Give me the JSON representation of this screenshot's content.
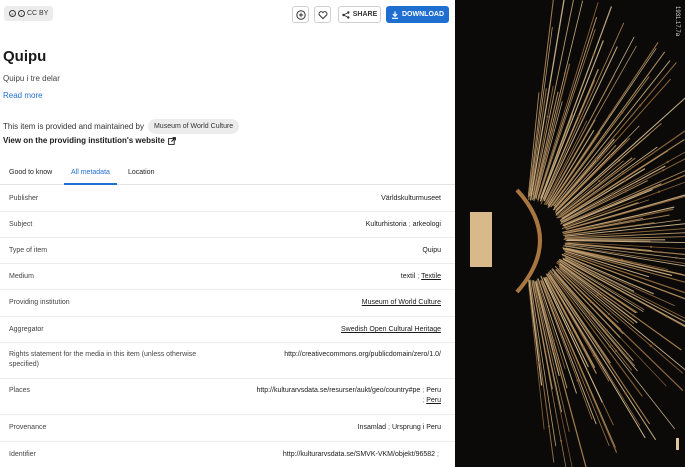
{
  "license": {
    "label": "CC BY"
  },
  "toolbar": {
    "add_icon": "plus-circle-icon",
    "favorite_icon": "heart-icon",
    "share_label": "SHARE",
    "download_label": "DOWNLOAD"
  },
  "item": {
    "title": "Quipu",
    "subtitle": "Quipu i tre delar",
    "read_more": "Read more",
    "provided_text": "This item is provided and maintained by",
    "provider_chip": "Museum of World Culture",
    "view_site": "View on the providing institution's website"
  },
  "tabs": [
    {
      "label": "Good to know"
    },
    {
      "label": "All metadata"
    },
    {
      "label": "Location"
    }
  ],
  "metadata": [
    {
      "label": "Publisher",
      "values": [
        "Världskulturmuseet"
      ]
    },
    {
      "label": "Subject",
      "values": [
        "Kulturhistoria",
        "arkeologi"
      ]
    },
    {
      "label": "Type of item",
      "values": [
        "Quipu"
      ]
    },
    {
      "label": "Medium",
      "values": [
        "textil",
        "Textile"
      ]
    },
    {
      "label": "Providing institution",
      "values": [
        "Museum of World Culture"
      ]
    },
    {
      "label": "Aggregator",
      "values": [
        "Swedish Open Cultural Heritage"
      ]
    },
    {
      "label": "Rights statement for the media in this item (unless otherwise specified)",
      "values": [
        "http://creativecommons.org/publicdomain/zero/1.0/"
      ]
    },
    {
      "label": "Places",
      "values": [
        "http://kulturarvsdata.se/resurser/aukt/geo/country#pe",
        "Peru",
        "Peru"
      ]
    },
    {
      "label": "Provenance",
      "values": [
        "Insamlad",
        "Ursprung i Peru"
      ]
    },
    {
      "label": "Identifier",
      "values": [
        "http://kulturarvsdata.se/SMVK-VKM/objekt/96582"
      ]
    }
  ],
  "image": {
    "edge_label": "1931.17.7a"
  }
}
